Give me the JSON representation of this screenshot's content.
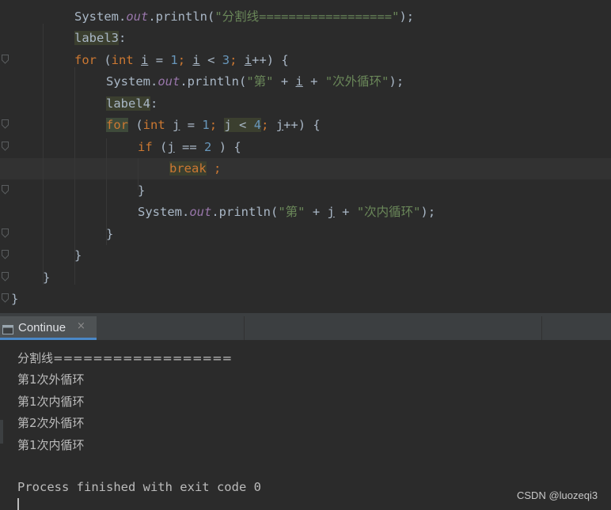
{
  "editor": {
    "lines": [
      {
        "tokens": [
          [
            "",
            "System."
          ],
          [
            "fld",
            "out"
          ],
          [
            "",
            ".println("
          ],
          [
            "str",
            "\"分割线==================\""
          ],
          [
            "",
            ");"
          ]
        ]
      },
      {
        "tokens": [
          [
            "hl",
            "label3"
          ],
          [
            "",
            ":"
          ]
        ]
      },
      {
        "tokens": [
          [
            "kw",
            "for"
          ],
          [
            "",
            " ("
          ],
          [
            "kw",
            "int"
          ],
          [
            "",
            " "
          ],
          [
            "ul",
            "i"
          ],
          [
            "",
            " = "
          ],
          [
            "num",
            "1"
          ],
          [
            "kw",
            ";"
          ],
          [
            "",
            " "
          ],
          [
            "ul",
            "i"
          ],
          [
            "",
            " < "
          ],
          [
            "num",
            "3"
          ],
          [
            "kw",
            ";"
          ],
          [
            "",
            " "
          ],
          [
            "ul",
            "i"
          ],
          [
            "",
            "++) {"
          ]
        ]
      },
      {
        "tokens": [
          [
            "",
            "System."
          ],
          [
            "fld",
            "out"
          ],
          [
            "",
            ".println("
          ],
          [
            "str",
            "\"第\""
          ],
          [
            "",
            " + "
          ],
          [
            "ul",
            "i"
          ],
          [
            "",
            " + "
          ],
          [
            "str",
            "\"次外循环\""
          ],
          [
            "",
            ");"
          ]
        ]
      },
      {
        "tokens": [
          [
            "hl",
            "label4"
          ],
          [
            "",
            ":"
          ]
        ]
      },
      {
        "tokens": [
          [
            "hl2",
            "for"
          ],
          [
            "",
            " ("
          ],
          [
            "kw",
            "int"
          ],
          [
            "",
            " "
          ],
          [
            "ul",
            "j"
          ],
          [
            "",
            " = "
          ],
          [
            "num",
            "1"
          ],
          [
            "kw",
            ";"
          ],
          [
            "",
            " "
          ],
          [
            "hl",
            "j < "
          ],
          [
            "hlnum",
            "4"
          ],
          [
            "kw",
            ";"
          ],
          [
            "",
            " "
          ],
          [
            "ul",
            "j"
          ],
          [
            "",
            "++) {"
          ]
        ]
      },
      {
        "tokens": [
          [
            "kw",
            "if"
          ],
          [
            "",
            " ("
          ],
          [
            "ul",
            "j"
          ],
          [
            "",
            " == "
          ],
          [
            "num",
            "2"
          ],
          [
            "",
            " ) {"
          ]
        ]
      },
      {
        "tokens": [
          [
            "hlkw",
            "break"
          ],
          [
            "",
            " "
          ],
          [
            "kw",
            ";"
          ]
        ]
      },
      {
        "tokens": [
          [
            "",
            "}"
          ]
        ]
      },
      {
        "tokens": [
          [
            "",
            "System."
          ],
          [
            "fld",
            "out"
          ],
          [
            "",
            ".println("
          ],
          [
            "str",
            "\"第\""
          ],
          [
            "",
            " + "
          ],
          [
            "ul",
            "j"
          ],
          [
            "",
            " + "
          ],
          [
            "str",
            "\"次内循环\""
          ],
          [
            "",
            ");"
          ]
        ]
      },
      {
        "tokens": [
          [
            "",
            "}"
          ]
        ]
      },
      {
        "tokens": [
          [
            "",
            "}"
          ]
        ]
      },
      {
        "tokens": [
          [
            "",
            "}"
          ]
        ]
      },
      {
        "tokens": [
          [
            "",
            "}"
          ]
        ]
      }
    ]
  },
  "run_panel": {
    "tab_label": "Continue",
    "tab_close": "×",
    "output": [
      "分割线==================",
      "第1次外循环",
      "第1次内循环",
      "第2次外循环",
      "第1次内循环",
      "",
      "Process finished with exit code 0"
    ]
  },
  "watermark": "CSDN @luozeqi3",
  "colors": {
    "background": "#2b2b2b",
    "keyword": "#cc7832",
    "number": "#6897bb",
    "string": "#6a8759",
    "field": "#9876aa",
    "text": "#a9b7c6",
    "tab_accent": "#4a88c7"
  }
}
